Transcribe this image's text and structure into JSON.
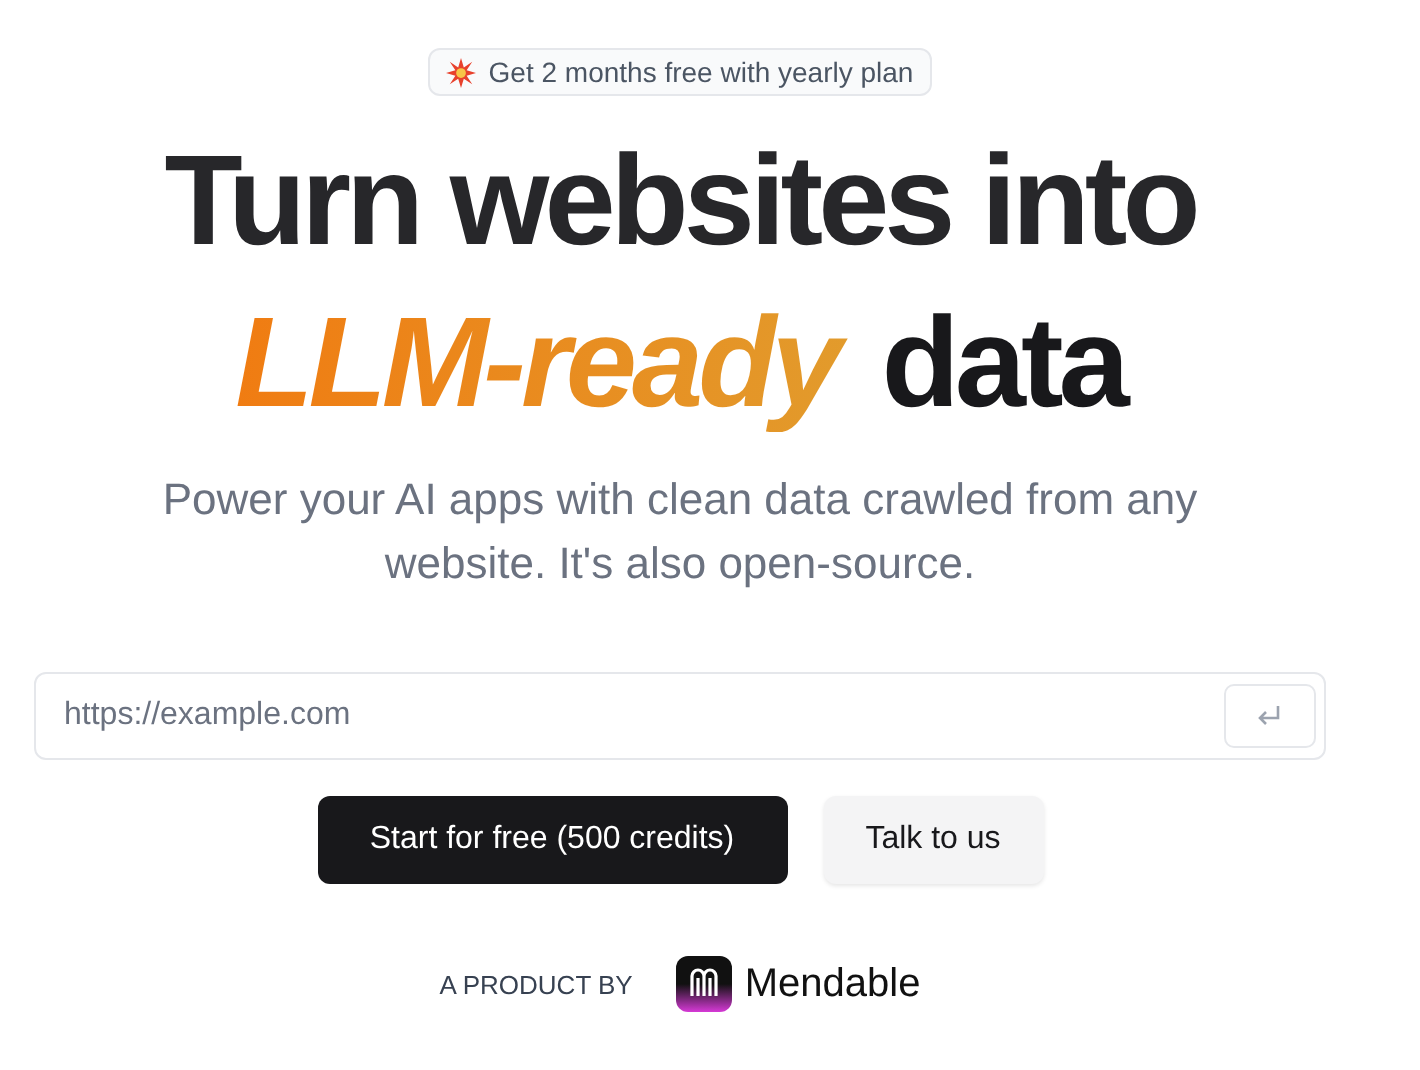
{
  "promo": {
    "text": "Get 2 months free with yearly plan"
  },
  "headline": {
    "line1": "Turn websites into",
    "highlight": "LLM-ready",
    "rest": "data"
  },
  "subtitle": "Power your AI apps with clean data crawled from any website. It's also open-source.",
  "url_input": {
    "placeholder": "https://example.com"
  },
  "buttons": [
    {
      "label": "Start for free (500 credits)",
      "kind": "primary"
    },
    {
      "label": "Talk to us",
      "kind": "secondary"
    }
  ],
  "footer": {
    "caption": "A PRODUCT BY",
    "brand": "Mendable"
  }
}
